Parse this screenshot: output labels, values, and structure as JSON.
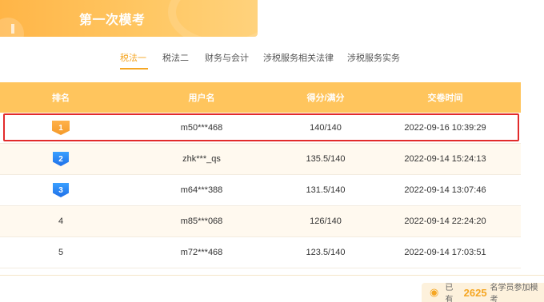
{
  "banner": {
    "title": "第一次模考"
  },
  "tabs": [
    {
      "label": "税法一",
      "active": true
    },
    {
      "label": "税法二",
      "active": false
    },
    {
      "label": "财务与会计",
      "active": false
    },
    {
      "label": "涉税服务相关法律",
      "active": false
    },
    {
      "label": "涉税服务实务",
      "active": false
    }
  ],
  "table": {
    "headers": {
      "rank": "排名",
      "user": "用户名",
      "score": "得分/满分",
      "time": "交卷时间"
    },
    "rows": [
      {
        "rank": "1",
        "badge": "gold",
        "user": "m50***468",
        "score": "140/140",
        "time": "2022-09-16 10:39:29"
      },
      {
        "rank": "2",
        "badge": "blue",
        "user": "zhk***_qs",
        "score": "135.5/140",
        "time": "2022-09-14 15:24:13"
      },
      {
        "rank": "3",
        "badge": "blue",
        "user": "m64***388",
        "score": "131.5/140",
        "time": "2022-09-14 13:07:46"
      },
      {
        "rank": "4",
        "badge": "",
        "user": "m85***068",
        "score": "126/140",
        "time": "2022-09-14 22:24:20"
      },
      {
        "rank": "5",
        "badge": "",
        "user": "m72***468",
        "score": "123.5/140",
        "time": "2022-09-14 17:03:51"
      }
    ]
  },
  "stat": {
    "prefix": "已有",
    "count": "2625",
    "suffix": "名学员参加模考"
  },
  "colors": {
    "accent": "#f5a623",
    "header_bg": "#ffc55d",
    "highlight": "#e22b2b",
    "badge_blue": "#1f6fe8"
  }
}
